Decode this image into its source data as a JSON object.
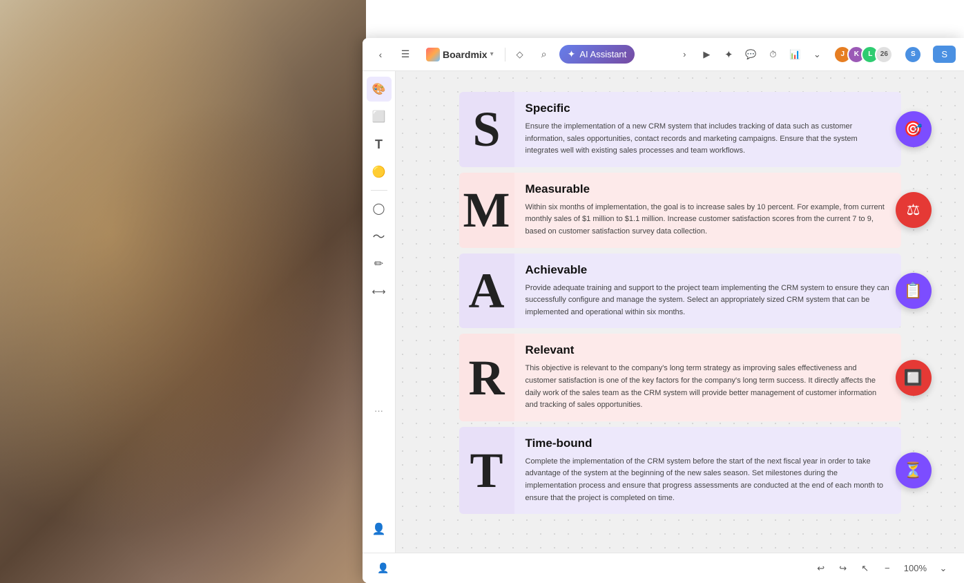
{
  "background": {
    "description": "office background photo with person at laptop"
  },
  "topbar": {
    "back_label": "‹",
    "menu_label": "☰",
    "brand_name": "Boardmix",
    "tag_label": "◇",
    "search_label": "⌕",
    "ai_assistant_label": "AI Assistant",
    "more_label": "›",
    "play_label": "▶",
    "celebrate_label": "✦",
    "comment_label": "💬",
    "timer_label": "⏱",
    "chart_label": "📊",
    "dropdown_label": "⌄",
    "avatar_count": "26",
    "user_label": "S",
    "share_label": "S"
  },
  "toolbar": {
    "tools": [
      {
        "name": "rainbow-tool",
        "icon": "🎨"
      },
      {
        "name": "frame-tool",
        "icon": "⬜"
      },
      {
        "name": "text-tool",
        "icon": "T"
      },
      {
        "name": "sticky-tool",
        "icon": "🟡"
      },
      {
        "name": "shape-tool",
        "icon": "◯"
      },
      {
        "name": "pen-tool",
        "icon": "〜"
      },
      {
        "name": "eraser-tool",
        "icon": "✏"
      },
      {
        "name": "connector-tool",
        "icon": "⟷"
      }
    ],
    "more_label": "···"
  },
  "smart": {
    "rows": [
      {
        "id": "s",
        "letter": "S",
        "title": "Specific",
        "text": "Ensure the implementation of a new CRM system that includes tracking of data such as customer information, sales opportunities, contact records and marketing campaigns. Ensure that the system integrates well with existing sales processes and team workflows.",
        "icon": "🎯",
        "icon_bg": "#7c4dff",
        "letter_bg": "#e8e0f8",
        "content_bg": "#ede8fb"
      },
      {
        "id": "m",
        "letter": "M",
        "title": "Measurable",
        "text": "Within six months of implementation, the goal is to increase sales by 10 percent. For example, from current monthly sales of $1 million to $1.1 million.\nIncrease customer satisfaction scores from the current 7 to 9, based on customer satisfaction survey data collection.",
        "icon": "⚖",
        "icon_bg": "#e53935",
        "letter_bg": "#fce4e4",
        "content_bg": "#fdeaea"
      },
      {
        "id": "a",
        "letter": "A",
        "title": "Achievable",
        "text": "Provide adequate training and support to the project team implementing the CRM system to ensure they can successfully configure and manage the system.\nSelect an appropriately sized CRM system that can be implemented and operational within six months.",
        "icon": "📋",
        "icon_bg": "#7c4dff",
        "letter_bg": "#e8e0f8",
        "content_bg": "#ede8fb"
      },
      {
        "id": "r",
        "letter": "R",
        "title": "Relevant",
        "text": "This objective is relevant to the company's long term strategy as improving sales effectiveness and customer satisfaction is one of the key factors for the company's long term success. It directly affects the daily work of the sales team as the CRM system will provide better management of customer information and tracking of sales opportunities.",
        "icon": "🔲",
        "icon_bg": "#e53935",
        "letter_bg": "#fce4e4",
        "content_bg": "#fdeaea"
      },
      {
        "id": "t",
        "letter": "T",
        "title": "Time-bound",
        "text": "Complete the implementation of the CRM system before the start of the next fiscal year in order to take advantage of the system at the beginning of the new sales season. Set milestones during the implementation process and ensure that progress assessments are conducted at the end of each month to ensure that the project is completed on time.",
        "icon": "⏳",
        "icon_bg": "#7c4dff",
        "letter_bg": "#e8e0f8",
        "content_bg": "#ede8fb"
      }
    ]
  },
  "bottom_toolbar": {
    "undo_label": "↩",
    "redo_label": "↪",
    "pointer_label": "↖",
    "zoom_out_label": "−",
    "zoom_level": "100%",
    "zoom_dropdown": "⌄",
    "presenter_label": "👤"
  }
}
